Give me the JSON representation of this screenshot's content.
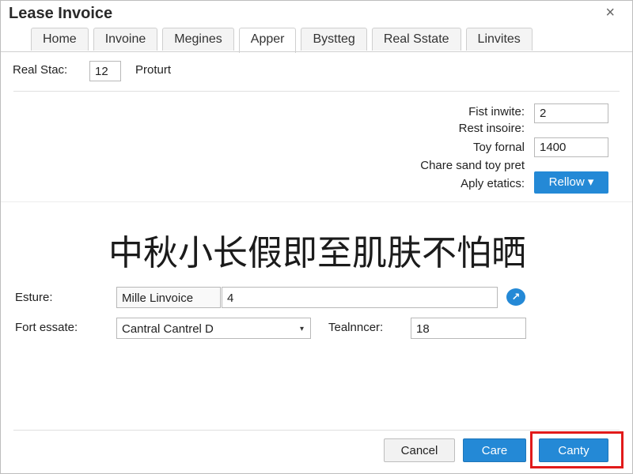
{
  "window": {
    "title": "Lease Invoice",
    "close_glyph": "×"
  },
  "tabs": [
    {
      "label": "Home"
    },
    {
      "label": "Invoine"
    },
    {
      "label": "Megines"
    },
    {
      "label": "Apper",
      "active": true
    },
    {
      "label": "Bystteg"
    },
    {
      "label": "Real Sstate"
    },
    {
      "label": "Linvites"
    }
  ],
  "top_row": {
    "label": "Real Stac:",
    "value": "12",
    "suffix": "Proturt"
  },
  "right_form": {
    "first_invite_label": "Fist inwite:",
    "first_invite_value": "2",
    "rest_label": "Rest insoire:",
    "toy_label": "Toy fornal",
    "toy_value": "1400",
    "chare_label": "Chare sand toy pret",
    "aply_label": "Aply etatics:",
    "reflow_label": "Rellow",
    "dropdown_glyph": "▾"
  },
  "overlay_text": "中秋小长假即至肌肤不怕晒",
  "lower_form": {
    "esture_label": "Esture:",
    "esture_name": "Mille Linvoice",
    "esture_value": "4",
    "info_glyph": "↗",
    "fort_label": "Fort essate:",
    "fort_select": "Cantral Cantrel D",
    "select_glyph": "▾",
    "team_label": "Tealnncer:",
    "team_value": "18"
  },
  "footer": {
    "cancel_label": "Cancel",
    "care_label": "Care",
    "canty_label": "Canty"
  },
  "colors": {
    "accent": "#2489d6",
    "highlight": "#e11a1a"
  }
}
